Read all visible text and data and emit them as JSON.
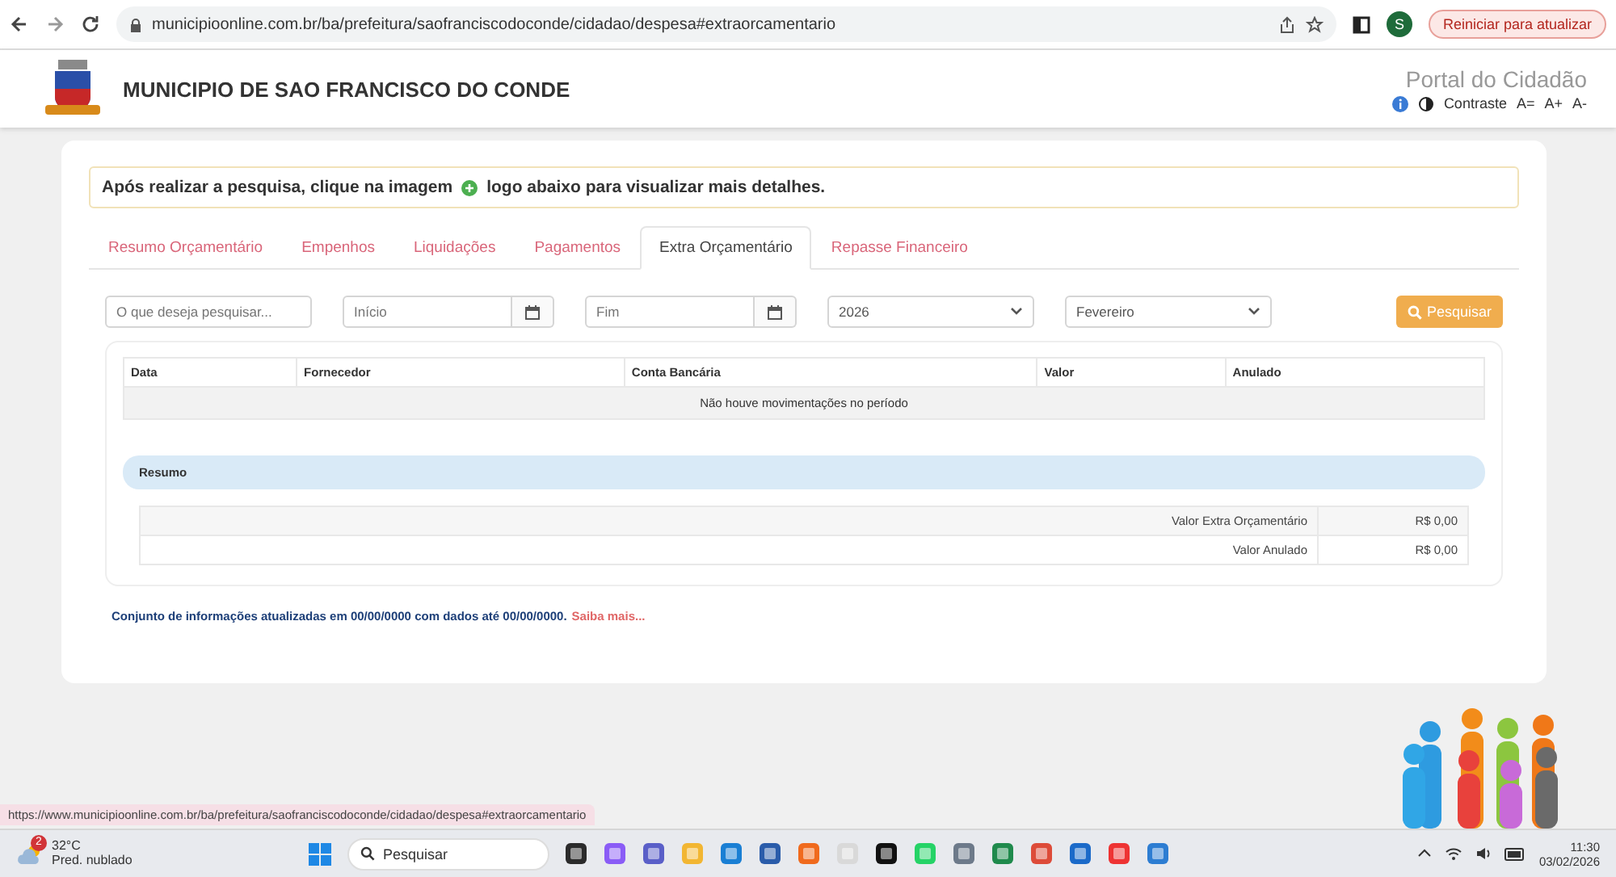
{
  "browser": {
    "url": "municipioonline.com.br/ba/prefeitura/saofranciscodoconde/cidadao/despesa#extraorcamentario",
    "profile_initial": "S",
    "update_button": "Reiniciar para atualizar"
  },
  "header": {
    "title": "MUNICIPIO DE SAO FRANCISCO DO CONDE",
    "portal": "Portal do Cidadão",
    "contrast": "Contraste",
    "font_buttons": [
      "A=",
      "A+",
      "A-"
    ]
  },
  "notice": {
    "before": "Após realizar a pesquisa, clique na imagem",
    "after": "logo abaixo para visualizar mais detalhes."
  },
  "tabs": [
    {
      "label": "Resumo Orçamentário",
      "selected": false
    },
    {
      "label": "Empenhos",
      "selected": false
    },
    {
      "label": "Liquidações",
      "selected": false
    },
    {
      "label": "Pagamentos",
      "selected": false
    },
    {
      "label": "Extra Orçamentário",
      "selected": true
    },
    {
      "label": "Repasse Financeiro",
      "selected": false
    }
  ],
  "filters": {
    "search_placeholder": "O que deseja pesquisar...",
    "start_placeholder": "Início",
    "end_placeholder": "Fim",
    "year": "2026",
    "month": "Fevereiro",
    "button": "Pesquisar"
  },
  "table": {
    "columns": [
      "Data",
      "Fornecedor",
      "Conta Bancária",
      "Valor",
      "Anulado"
    ],
    "empty_message": "Não houve movimentações no período"
  },
  "summary": {
    "title": "Resumo",
    "rows": [
      {
        "label": "Valor Extra Orçamentário",
        "value": "R$ 0,00"
      },
      {
        "label": "Valor Anulado",
        "value": "R$ 0,00"
      }
    ]
  },
  "footer_note": {
    "text": "Conjunto de informações atualizadas em 00/00/0000 com dados até 00/00/0000.",
    "link": "Saiba mais..."
  },
  "status_url": "https://www.municipioonline.com.br/ba/prefeitura/saofranciscodoconde/cidadao/despesa#extraorcamentario",
  "taskbar": {
    "weather_badge": "2",
    "temperature": "32°C",
    "weather": "Pred. nublado",
    "search": "Pesquisar",
    "time": "11:30",
    "date": "03/02/2026"
  }
}
